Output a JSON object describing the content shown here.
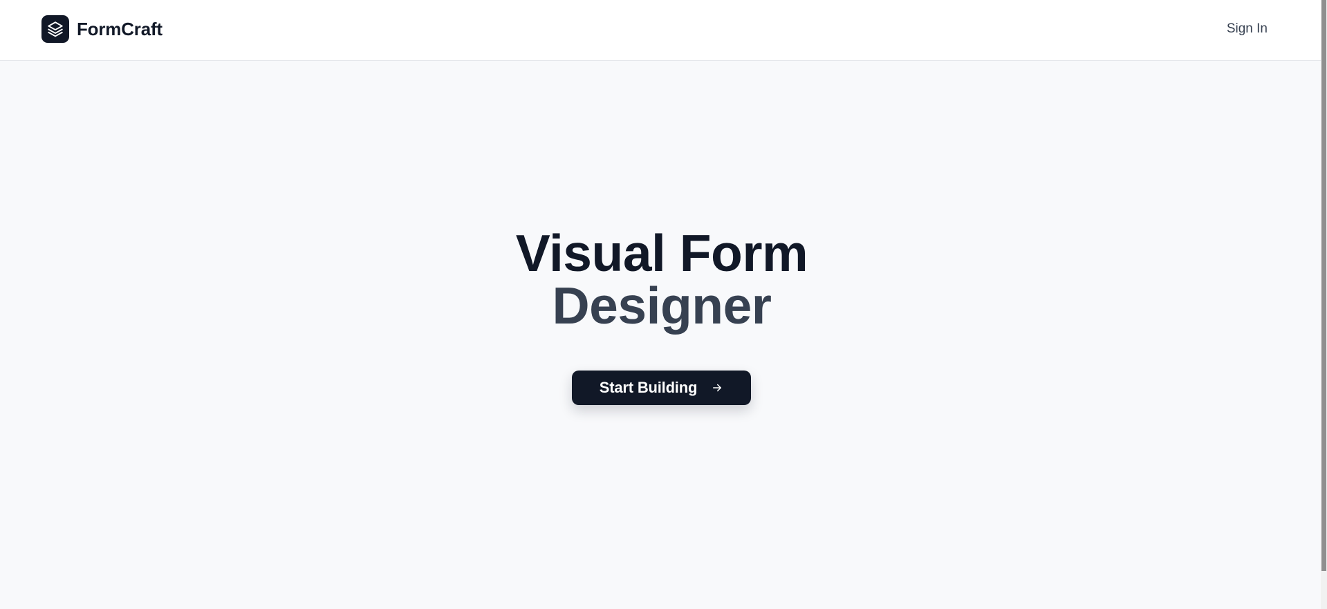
{
  "header": {
    "brand_name": "FormCraft",
    "logo_icon": "layers-icon",
    "sign_in_label": "Sign In"
  },
  "hero": {
    "title_line1": "Visual Form",
    "title_line2": "Designer",
    "cta_label": "Start Building",
    "cta_icon": "arrow-right-icon"
  },
  "colors": {
    "primary": "#111827",
    "secondary_text": "#374151",
    "background": "#f8f9fb",
    "header_bg": "#ffffff",
    "border": "#e5e7eb"
  }
}
